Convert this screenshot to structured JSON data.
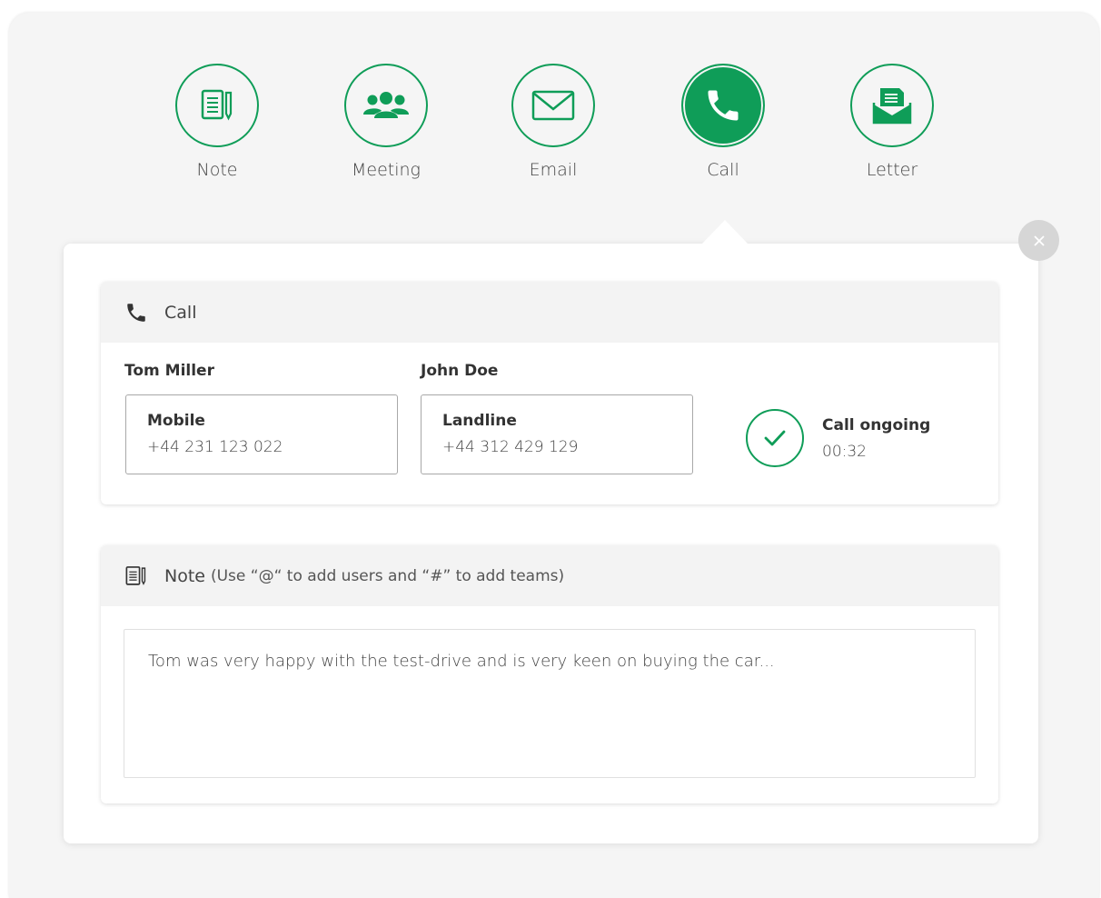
{
  "activity_types": [
    {
      "label": "Note",
      "icon": "note-icon",
      "active": false
    },
    {
      "label": "Meeting",
      "icon": "meeting-icon",
      "active": false
    },
    {
      "label": "Email",
      "icon": "email-icon",
      "active": false
    },
    {
      "label": "Call",
      "icon": "phone-icon",
      "active": true
    },
    {
      "label": "Letter",
      "icon": "letter-icon",
      "active": false
    }
  ],
  "colors": {
    "accent": "#0f9d58",
    "background": "#f5f5f5",
    "header_bg": "#f3f3f3"
  },
  "call_section": {
    "title": "Call",
    "caller": {
      "name": "Tom Miller",
      "phone_type": "Mobile",
      "phone": "+44 231 123 022"
    },
    "callee": {
      "name": "John Doe",
      "phone_type": "Landline",
      "phone": "+44 312 429 129"
    },
    "status": {
      "label": "Call ongoing",
      "duration": "00:32"
    }
  },
  "note_section": {
    "title": "Note",
    "hint": "(Use “@“ to add users and “#” to add teams)",
    "text": "Tom was very happy with the test-drive and is very keen on buying the car..."
  }
}
